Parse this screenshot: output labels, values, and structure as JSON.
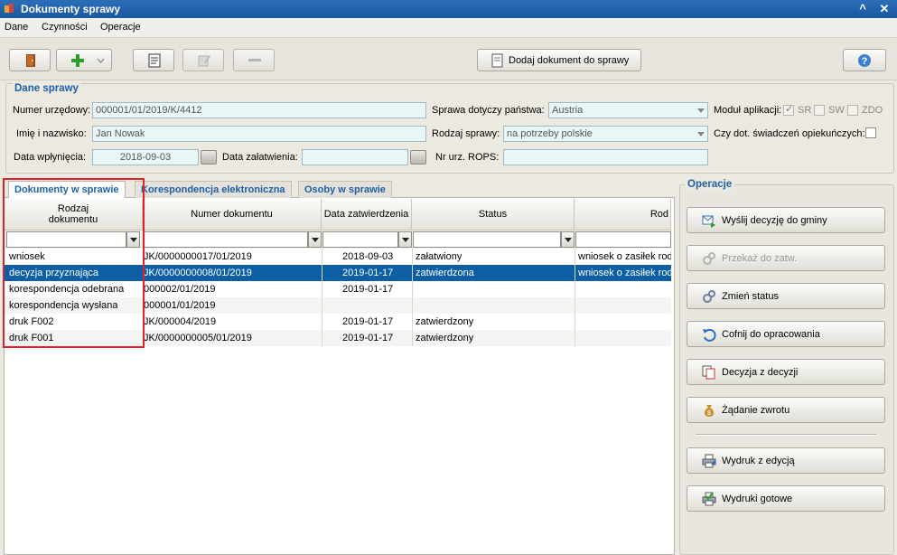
{
  "window": {
    "title": "Dokumenty sprawy",
    "minimize_glyph": "^",
    "close_glyph": "✕"
  },
  "menu": [
    "Dane",
    "Czynności",
    "Operacje"
  ],
  "toolbar": {
    "add_document_label": "Dodaj dokument do sprawy"
  },
  "case": {
    "group_title": "Dane sprawy",
    "numer_urzedowy_label": "Numer urzędowy:",
    "numer_urzedowy": "000001/01/2019/K/4412",
    "imie_label": "Imię i nazwisko:",
    "imie": "Jan Nowak",
    "data_wplyniecia_label": "Data wpłynięcia:",
    "data_wplyniecia": "2018-09-03",
    "data_zalatwienia_label": "Data załatwienia:",
    "data_zalatwienia": "",
    "panstwo_label": "Sprawa dotyczy państwa:",
    "panstwo": "Austria",
    "rodzaj_label": "Rodzaj sprawy:",
    "rodzaj": "na potrzeby polskie",
    "rops_label": "Nr urz. ROPS:",
    "rops": "",
    "modul_label": "Moduł aplikacji:",
    "modul_sr": "SR",
    "modul_sw": "SW",
    "modul_zdo": "ZDO",
    "swiadczenia_label": "Czy dot. świadczeń opiekuńczych:"
  },
  "tabs": [
    {
      "label": "Dokumenty w sprawie"
    },
    {
      "label": "Korespondencja elektroniczna"
    },
    {
      "label": "Osoby w sprawie"
    }
  ],
  "grid": {
    "headers": {
      "rodzaj_line1": "Rodzaj",
      "rodzaj_line2": "dokumentu",
      "numer": "Numer dokumentu",
      "data": "Data zatwierdzenia",
      "status": "Status",
      "rod": "Rod"
    },
    "rows": [
      {
        "rodzaj": "wniosek",
        "numer": "JK/0000000017/01/2019",
        "data": "2018-09-03",
        "status": "załatwiony",
        "rod": "wniosek o zasiłek rod"
      },
      {
        "rodzaj": "decyzja przyznająca",
        "numer": "JK/0000000008/01/2019",
        "data": "2019-01-17",
        "status": "zatwierdzona",
        "rod": "wniosek o zasiłek rod"
      },
      {
        "rodzaj": "korespondencja odebrana",
        "numer": "000002/01/2019",
        "data": "2019-01-17",
        "status": "",
        "rod": ""
      },
      {
        "rodzaj": "korespondencja wysłana",
        "numer": "000001/01/2019",
        "data": "",
        "status": "",
        "rod": ""
      },
      {
        "rodzaj": "druk F002",
        "numer": "JK/000004/2019",
        "data": "2019-01-17",
        "status": "zatwierdzony",
        "rod": ""
      },
      {
        "rodzaj": "druk F001",
        "numer": "JK/0000000005/01/2019",
        "data": "2019-01-17",
        "status": "zatwierdzony",
        "rod": ""
      }
    ]
  },
  "operations": {
    "title": "Operacje",
    "buttons": [
      {
        "label": "Wyślij decyzję do gminy",
        "icon": "send-icon"
      },
      {
        "label": "Przekaż do zatw.",
        "icon": "gears-icon"
      },
      {
        "label": "Zmień status",
        "icon": "gears-icon"
      },
      {
        "label": "Cofnij do opracowania",
        "icon": "undo-icon"
      },
      {
        "label": "Decyzja z decyzji",
        "icon": "copy-doc-icon"
      },
      {
        "label": "Żądanie zwrotu",
        "icon": "money-bag-icon"
      },
      {
        "label": "Wydruk z edycją",
        "icon": "print-edit-icon"
      },
      {
        "label": "Wydruki gotowe",
        "icon": "print-ready-icon"
      }
    ]
  },
  "colors": {
    "accent": "#1d5fa8",
    "selection": "#0c5fa3",
    "highlight_box": "#e0202a",
    "input_bg": "#e8f6f6"
  }
}
